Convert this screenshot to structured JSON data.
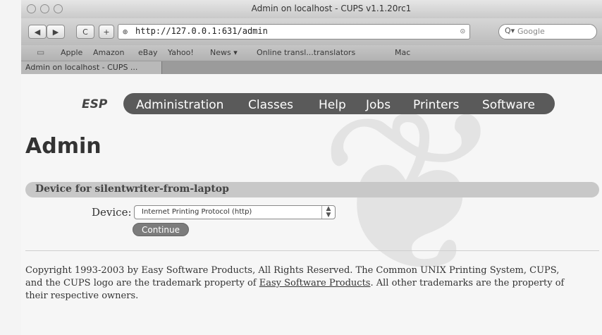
{
  "window": {
    "title": "Admin on localhost - CUPS v1.1.20rc1"
  },
  "toolbar": {
    "back_icon": "back-arrow-icon",
    "forward_icon": "forward-arrow-icon",
    "reload_label": "C",
    "add_label": "+",
    "url": "http://127.0.0.1:631/admin",
    "search_placeholder": "Google"
  },
  "bookmarks": [
    "Apple",
    "Amazon",
    "eBay",
    "Yahoo!",
    "News ▾",
    "Online transl...translators",
    "Mac"
  ],
  "tab": {
    "label": "Admin on localhost - CUPS ..."
  },
  "nav": {
    "brand": "ESP",
    "items": [
      "Administration",
      "Classes",
      "Help",
      "Jobs",
      "Printers",
      "Software"
    ]
  },
  "page": {
    "title": "Admin",
    "section_title": "Device for silentwriter-from-laptop",
    "device_label": "Device:",
    "device_value": "Internet Printing Protocol (http)",
    "continue_label": "Continue"
  },
  "footer": {
    "text_before": "Copyright 1993-2003 by Easy Software Products, All Rights Reserved. The Common UNIX Printing System, CUPS, and the CUPS logo are the trademark property of ",
    "link": "Easy Software Products",
    "text_after": ". All other trademarks are the property of their respective owners."
  },
  "colors": {
    "nav_bg": "#5a5a5a",
    "section_bar": "#c8c8c8",
    "button": "#7c7c7c"
  }
}
